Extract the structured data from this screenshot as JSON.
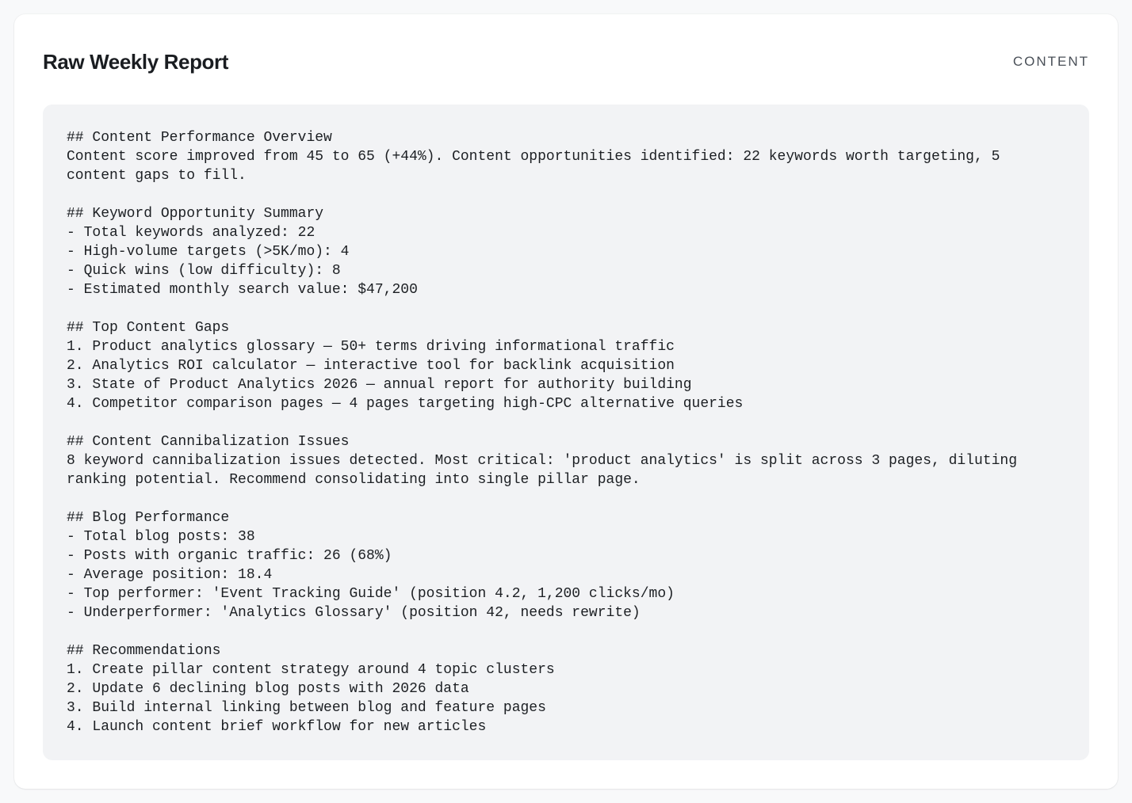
{
  "card": {
    "title": "Raw Weekly Report",
    "tag": "CONTENT"
  },
  "report": {
    "text": "## Content Performance Overview\nContent score improved from 45 to 65 (+44%). Content opportunities identified: 22 keywords worth targeting, 5\ncontent gaps to fill.\n\n## Keyword Opportunity Summary\n- Total keywords analyzed: 22\n- High-volume targets (>5K/mo): 4\n- Quick wins (low difficulty): 8\n- Estimated monthly search value: $47,200\n\n## Top Content Gaps\n1. Product analytics glossary — 50+ terms driving informational traffic\n2. Analytics ROI calculator — interactive tool for backlink acquisition\n3. State of Product Analytics 2026 — annual report for authority building\n4. Competitor comparison pages — 4 pages targeting high-CPC alternative queries\n\n## Content Cannibalization Issues\n8 keyword cannibalization issues detected. Most critical: 'product analytics' is split across 3 pages, diluting\nranking potential. Recommend consolidating into single pillar page.\n\n## Blog Performance\n- Total blog posts: 38\n- Posts with organic traffic: 26 (68%)\n- Average position: 18.4\n- Top performer: 'Event Tracking Guide' (position 4.2, 1,200 clicks/mo)\n- Underperformer: 'Analytics Glossary' (position 42, needs rewrite)\n\n## Recommendations\n1. Create pillar content strategy around 4 topic clusters\n2. Update 6 declining blog posts with 2026 data\n3. Build internal linking between blog and feature pages\n4. Launch content brief workflow for new articles"
  }
}
